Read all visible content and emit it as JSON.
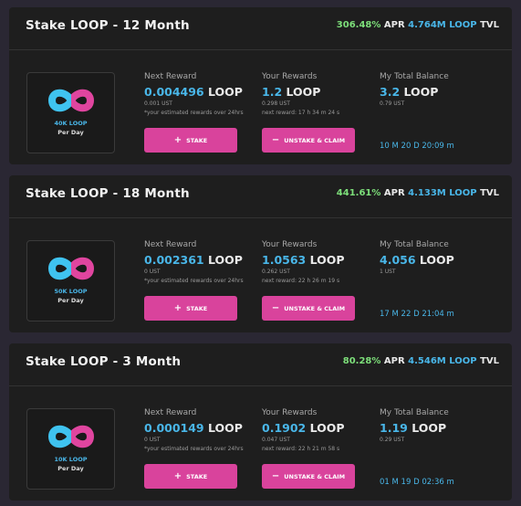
{
  "colors": {
    "accent_blue": "#49b6e8",
    "apr_green": "#7ddf7a",
    "button_pink": "#d9439c",
    "card_bg": "#1e1e1e"
  },
  "pools": [
    {
      "title": "Stake LOOP - 12 Month",
      "apr_value": "306.48%",
      "apr_label": "APR",
      "tvl_value": "4.764M",
      "tvl_token": "LOOP",
      "tvl_label": "TVL",
      "logo_rate": "40K LOOP",
      "logo_perday": "Per Day",
      "next_reward_label": "Next Reward",
      "next_reward_value": "0.004496",
      "next_reward_unit": "LOOP",
      "next_reward_ust": "0.001 UST",
      "next_reward_note": "*your estimated rewards over 24hrs",
      "your_rewards_label": "Your Rewards",
      "your_rewards_value": "1.2",
      "your_rewards_unit": "LOOP",
      "your_rewards_ust": "0.298 UST",
      "your_rewards_note": "next reward: 17 h 34 m 24 s",
      "balance_label": "My Total Balance",
      "balance_value": "3.2",
      "balance_unit": "LOOP",
      "balance_ust": "0.79 UST",
      "stake_label": "STAKE",
      "stake_symbol": "+",
      "unstake_label": "UNSTAKE & CLAIM",
      "unstake_symbol": "−",
      "countdown": "10 M 20 D 20:09 m"
    },
    {
      "title": "Stake LOOP - 18 Month",
      "apr_value": "441.61%",
      "apr_label": "APR",
      "tvl_value": "4.133M",
      "tvl_token": "LOOP",
      "tvl_label": "TVL",
      "logo_rate": "50K LOOP",
      "logo_perday": "Per Day",
      "next_reward_label": "Next Reward",
      "next_reward_value": "0.002361",
      "next_reward_unit": "LOOP",
      "next_reward_ust": "0 UST",
      "next_reward_note": "*your estimated rewards over 24hrs",
      "your_rewards_label": "Your Rewards",
      "your_rewards_value": "1.0563",
      "your_rewards_unit": "LOOP",
      "your_rewards_ust": "0.262 UST",
      "your_rewards_note": "next reward: 22 h 26 m 19 s",
      "balance_label": "My Total Balance",
      "balance_value": "4.056",
      "balance_unit": "LOOP",
      "balance_ust": "1 UST",
      "stake_label": "STAKE",
      "stake_symbol": "+",
      "unstake_label": "UNSTAKE & CLAIM",
      "unstake_symbol": "−",
      "countdown": "17 M 22 D 21:04 m"
    },
    {
      "title": "Stake LOOP - 3 Month",
      "apr_value": "80.28%",
      "apr_label": "APR",
      "tvl_value": "4.546M",
      "tvl_token": "LOOP",
      "tvl_label": "TVL",
      "logo_rate": "10K LOOP",
      "logo_perday": "Per Day",
      "next_reward_label": "Next Reward",
      "next_reward_value": "0.000149",
      "next_reward_unit": "LOOP",
      "next_reward_ust": "0 UST",
      "next_reward_note": "*your estimated rewards over 24hrs",
      "your_rewards_label": "Your Rewards",
      "your_rewards_value": "0.1902",
      "your_rewards_unit": "LOOP",
      "your_rewards_ust": "0.047 UST",
      "your_rewards_note": "next reward: 22 h 21 m 58 s",
      "balance_label": "My Total Balance",
      "balance_value": "1.19",
      "balance_unit": "LOOP",
      "balance_ust": "0.29 UST",
      "stake_label": "STAKE",
      "stake_symbol": "+",
      "unstake_label": "UNSTAKE & CLAIM",
      "unstake_symbol": "−",
      "countdown": "01 M 19 D 02:36 m"
    }
  ]
}
